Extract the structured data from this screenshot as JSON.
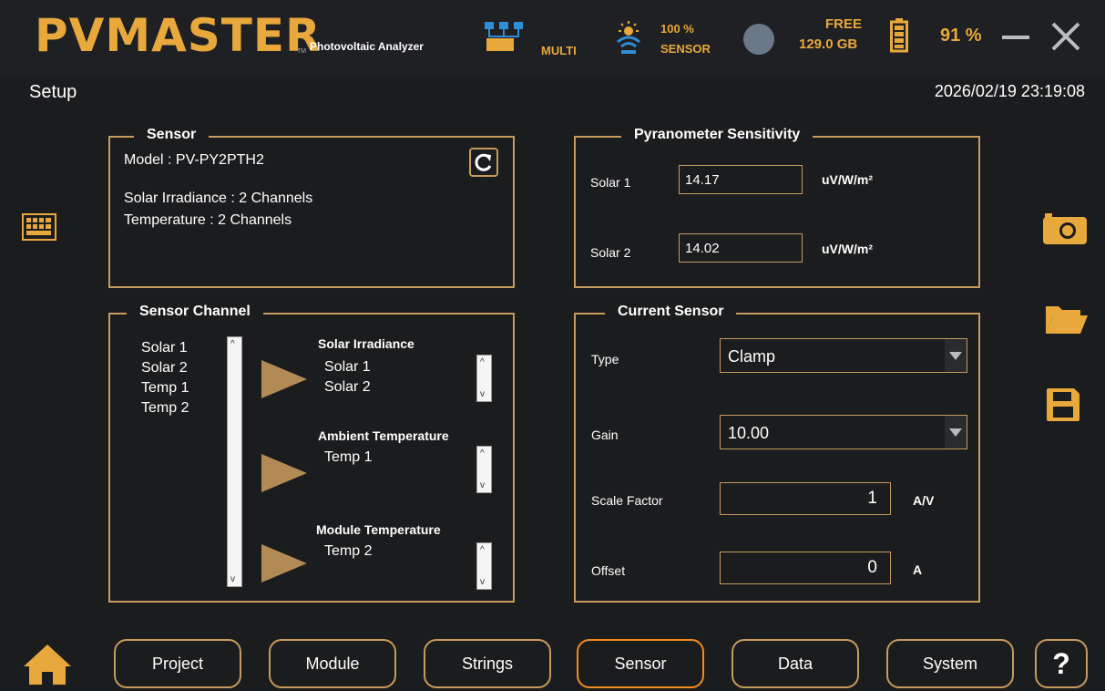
{
  "header": {
    "logo": "PVMASTER",
    "logo_tm": "TM",
    "subtitle": "Photovoltaic Analyzer",
    "multi_label": "MULTI",
    "sensor_signal": "100 %",
    "sensor_label": "SENSOR",
    "free_label": "FREE",
    "free_value": "129.0 GB",
    "battery_percent": "91 %"
  },
  "page": {
    "title": "Setup",
    "datetime": "2026/02/19 23:19:08"
  },
  "sensor": {
    "title": "Sensor",
    "model": "Model : PV-PY2PTH2",
    "irradiance": "Solar Irradiance : 2 Channels",
    "temperature": "Temperature : 2 Channels"
  },
  "pyranometer": {
    "title": "Pyranometer Sensitivity",
    "solar1_label": "Solar 1",
    "solar1_value": "14.17",
    "solar2_label": "Solar 2",
    "solar2_value": "14.02",
    "unit": "uV/W/m²"
  },
  "channel": {
    "title": "Sensor Channel",
    "list": [
      "Solar 1",
      "Solar 2",
      "Temp 1",
      "Temp 2"
    ],
    "irradiance_title": "Solar Irradiance",
    "irradiance_items": [
      "Solar 1",
      "Solar 2"
    ],
    "ambient_title": "Ambient Temperature",
    "ambient_items": [
      "Temp 1"
    ],
    "module_title": "Module Temperature",
    "module_items": [
      "Temp 2"
    ]
  },
  "current_sensor": {
    "title": "Current Sensor",
    "type_label": "Type",
    "type_value": "Clamp",
    "gain_label": "Gain",
    "gain_value": "10.00",
    "scale_label": "Scale Factor",
    "scale_value": "1",
    "scale_unit": "A/V",
    "offset_label": "Offset",
    "offset_value": "0",
    "offset_unit": "A"
  },
  "nav": {
    "project": "Project",
    "module": "Module",
    "strings": "Strings",
    "sensor": "Sensor",
    "data": "Data",
    "system": "System",
    "help": "?"
  },
  "colors": {
    "accent": "#e9a83b",
    "border": "#c79a5d",
    "active": "#f08b20",
    "background": "#1b1c1e"
  }
}
